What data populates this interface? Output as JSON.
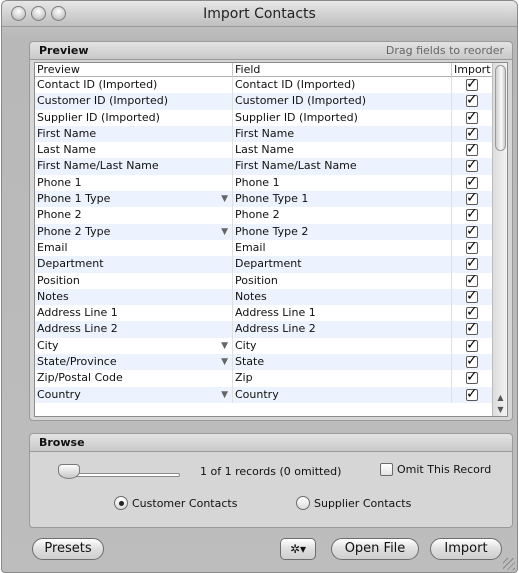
{
  "window": {
    "title": "Import Contacts"
  },
  "preview": {
    "label": "Preview",
    "hint": "Drag fields to reorder",
    "columns": [
      "Preview",
      "Field",
      "Import"
    ],
    "rows": [
      {
        "preview": "Contact ID (Imported)",
        "field": "Contact ID (Imported)",
        "dropdown": false,
        "checked": true
      },
      {
        "preview": "Customer ID (Imported)",
        "field": "Customer ID (Imported)",
        "dropdown": false,
        "checked": true
      },
      {
        "preview": "Supplier ID (Imported)",
        "field": "Supplier ID (Imported)",
        "dropdown": false,
        "checked": true
      },
      {
        "preview": "First Name",
        "field": "First Name",
        "dropdown": false,
        "checked": true
      },
      {
        "preview": "Last Name",
        "field": "Last Name",
        "dropdown": false,
        "checked": true
      },
      {
        "preview": "First Name/Last Name",
        "field": "First Name/Last Name",
        "dropdown": false,
        "checked": true
      },
      {
        "preview": "Phone 1",
        "field": "Phone 1",
        "dropdown": false,
        "checked": true
      },
      {
        "preview": "Phone 1 Type",
        "field": "Phone Type 1",
        "dropdown": true,
        "checked": true
      },
      {
        "preview": "Phone 2",
        "field": "Phone 2",
        "dropdown": false,
        "checked": true
      },
      {
        "preview": "Phone 2 Type",
        "field": "Phone Type 2",
        "dropdown": true,
        "checked": true
      },
      {
        "preview": "Email",
        "field": "Email",
        "dropdown": false,
        "checked": true
      },
      {
        "preview": "Department",
        "field": "Department",
        "dropdown": false,
        "checked": true
      },
      {
        "preview": "Position",
        "field": "Position",
        "dropdown": false,
        "checked": true
      },
      {
        "preview": "Notes",
        "field": "Notes",
        "dropdown": false,
        "checked": true
      },
      {
        "preview": "Address Line 1",
        "field": "Address Line 1",
        "dropdown": false,
        "checked": true
      },
      {
        "preview": "Address Line 2",
        "field": "Address Line 2",
        "dropdown": false,
        "checked": true
      },
      {
        "preview": "City",
        "field": "City",
        "dropdown": true,
        "checked": true
      },
      {
        "preview": "State/Province",
        "field": "State",
        "dropdown": true,
        "checked": true
      },
      {
        "preview": "Zip/Postal Code",
        "field": "Zip",
        "dropdown": false,
        "checked": true
      },
      {
        "preview": "Country",
        "field": "Country",
        "dropdown": true,
        "checked": true
      }
    ]
  },
  "browse": {
    "label": "Browse",
    "records": "1 of 1 records (0 omitted)",
    "omit_label": "Omit This Record",
    "omit_checked": false,
    "radio_customer": "Customer Contacts",
    "radio_supplier": "Supplier Contacts",
    "selected": "customer"
  },
  "buttons": {
    "presets": "Presets",
    "gear": "✲▾",
    "open_file": "Open File",
    "import": "Import"
  }
}
